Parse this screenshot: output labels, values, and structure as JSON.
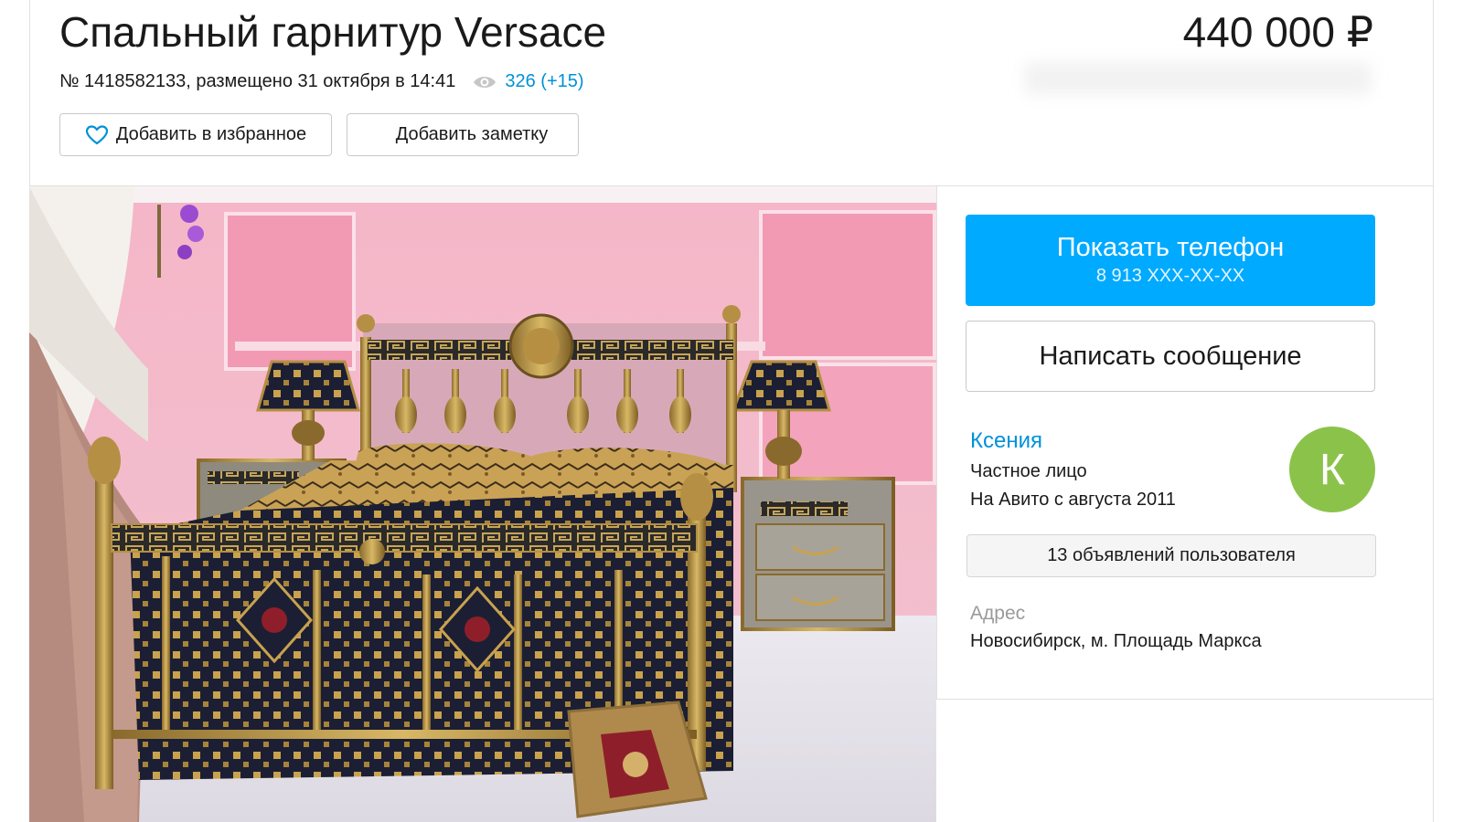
{
  "listing": {
    "title": "Спальный гарнитур Versace",
    "price": "440 000 ₽",
    "meta": "№ 1418582133, размещено 31 октября в 14:41",
    "views": "326 (+15)"
  },
  "actions": {
    "favorite_label": "Добавить в избранное",
    "note_label": "Добавить заметку"
  },
  "contact": {
    "phone_label": "Показать телефон",
    "phone_number": "8 913 XXX-XX-XX",
    "message_label": "Написать сообщение"
  },
  "seller": {
    "name": "Ксения",
    "type": "Частное лицо",
    "since": "На Авито с августа 2011",
    "avatar_letter": "К",
    "avatar_color": "#8bc34a",
    "ads_label": "13 объявлений пользователя"
  },
  "address": {
    "label": "Адрес",
    "value": "Новосибирск, м. Площадь Маркса"
  },
  "colors": {
    "accent": "#00aaff",
    "link": "#0091d9"
  },
  "icons": {
    "favorite": "heart-icon",
    "views": "eye-icon"
  }
}
